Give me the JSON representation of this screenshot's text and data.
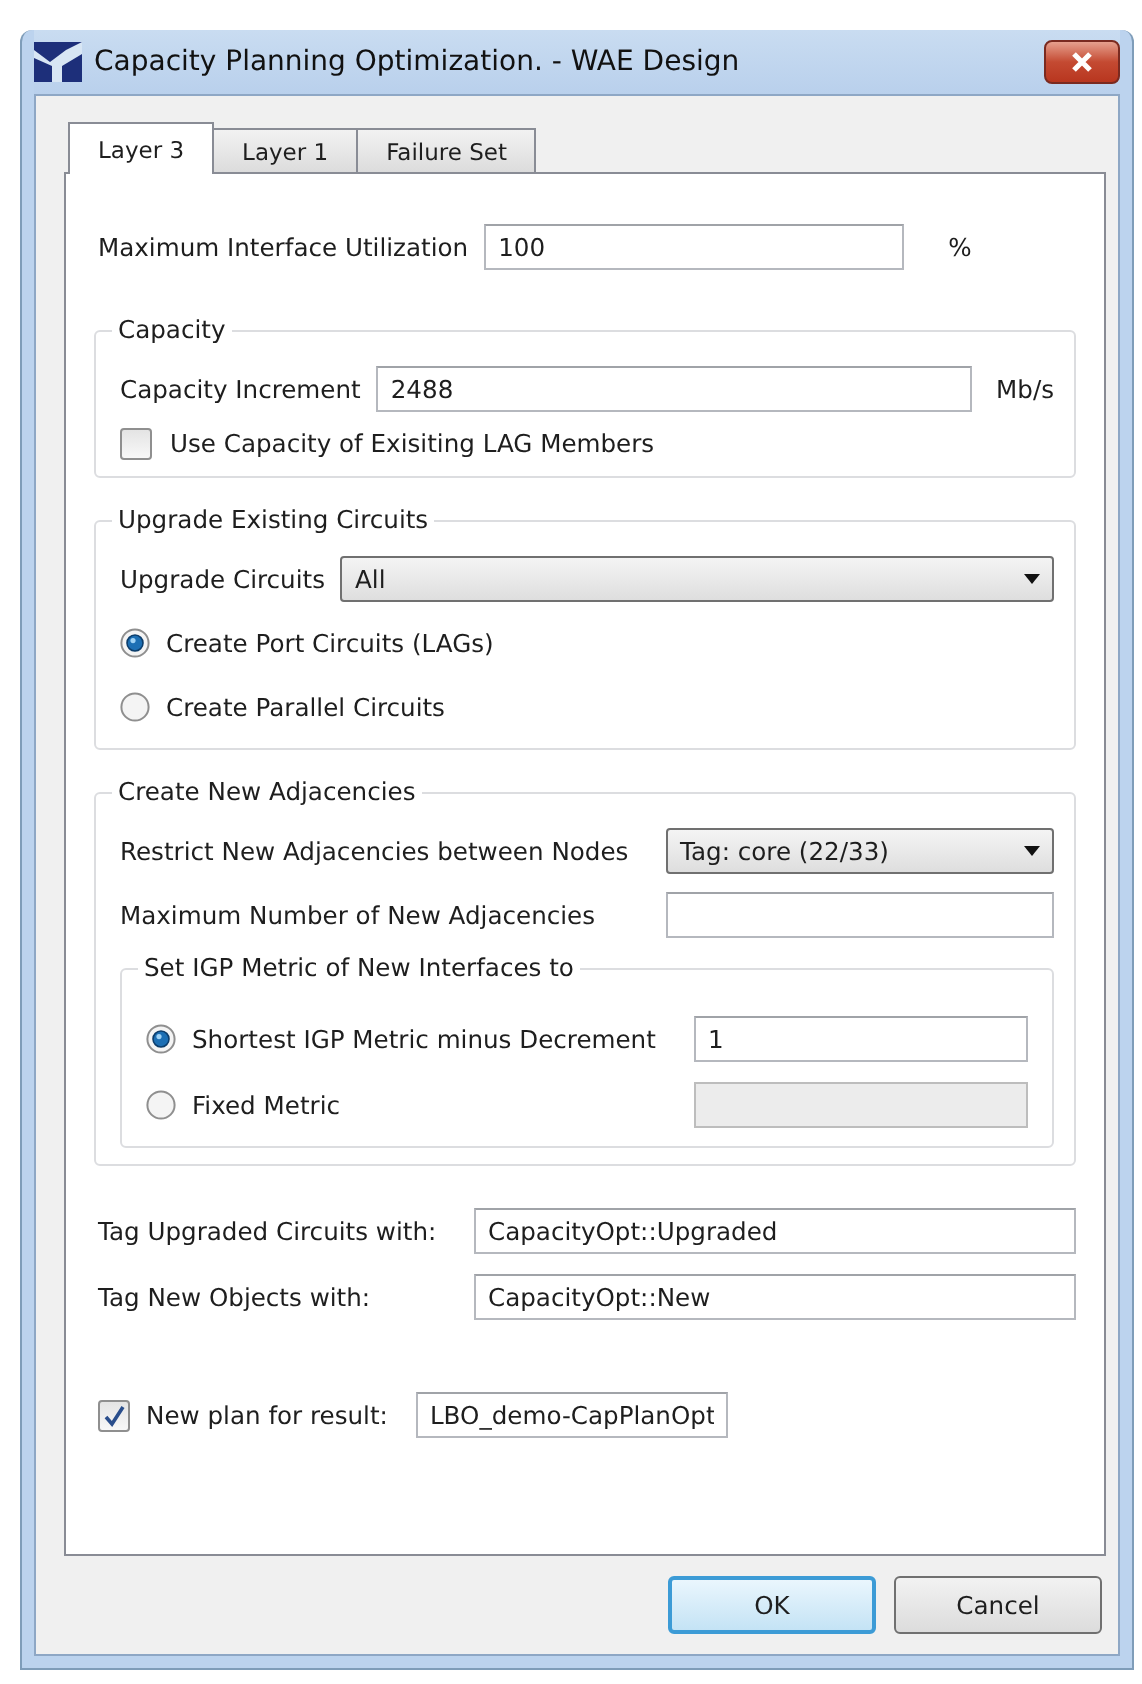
{
  "window": {
    "title": "Capacity Planning Optimization. - WAE Design"
  },
  "tabs": [
    {
      "label": "Layer 3",
      "selected": true
    },
    {
      "label": "Layer 1",
      "selected": false
    },
    {
      "label": "Failure Set",
      "selected": false
    }
  ],
  "max_utilization": {
    "label": "Maximum Interface Utilization",
    "value": "100",
    "unit": "%"
  },
  "capacity": {
    "title": "Capacity",
    "increment": {
      "label": "Capacity Increment",
      "value": "2488",
      "unit": "Mb/s"
    },
    "use_lag": {
      "label": "Use Capacity of Exisiting LAG Members",
      "checked": false
    }
  },
  "upgrade": {
    "title": "Upgrade Existing Circuits",
    "circuits": {
      "label": "Upgrade Circuits",
      "value": "All"
    },
    "options": [
      {
        "label": "Create Port Circuits (LAGs)",
        "selected": true
      },
      {
        "label": "Create Parallel Circuits",
        "selected": false
      }
    ]
  },
  "adjacencies": {
    "title": "Create New Adjacencies",
    "restrict": {
      "label": "Restrict New Adjacencies between Nodes",
      "value": "Tag: core (22/33)"
    },
    "max_new": {
      "label": "Maximum Number of New Adjacencies"
    },
    "igp": {
      "title": "Set IGP Metric of New Interfaces to",
      "options": [
        {
          "label": "Shortest IGP Metric minus Decrement",
          "selected": true,
          "value": "1",
          "disabled": false
        },
        {
          "label": "Fixed Metric",
          "selected": false,
          "disabled": true
        }
      ]
    }
  },
  "tags": [
    {
      "label": "Tag Upgraded Circuits with:",
      "value": "CapacityOpt::Upgraded"
    },
    {
      "label": "Tag New Objects with:",
      "value": "CapacityOpt::New"
    }
  ],
  "new_plan": {
    "label": "New plan for result:",
    "checked": true,
    "value": "LBO_demo-CapPlanOpt"
  },
  "buttons": [
    {
      "label": "OK",
      "default": true
    },
    {
      "label": "Cancel",
      "default": false
    }
  ]
}
